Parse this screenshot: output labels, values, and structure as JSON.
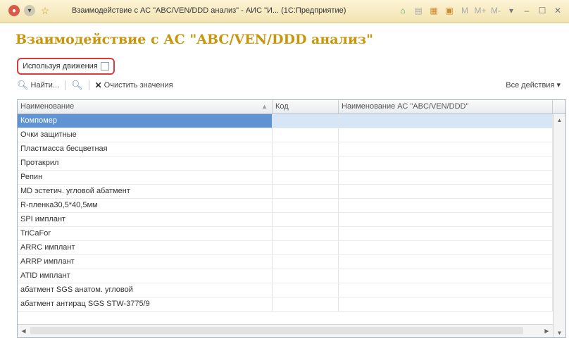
{
  "window": {
    "title": "Взаимодействие с АС \"ABC/VEN/DDD анализ\" - АИС \"И... (1С:Предприятие)"
  },
  "form": {
    "title": "Взаимодействие с АС \"ABC/VEN/DDD анализ\"",
    "use_movements_label": "Используя движения",
    "use_movements_checked": false
  },
  "toolbar": {
    "find_label": "Найти...",
    "clear_label": "Очистить значения",
    "all_actions_label": "Все действия ▾"
  },
  "table": {
    "columns": [
      "Наименование",
      "Код",
      "Наименование АС \"ABC/VEN/DDD\""
    ],
    "rows": [
      {
        "name": "Компомер",
        "code": "",
        "abc": ""
      },
      {
        "name": "Очки защитные",
        "code": "",
        "abc": ""
      },
      {
        "name": "Пластмасса бесцветная",
        "code": "",
        "abc": ""
      },
      {
        "name": "Протакрил",
        "code": "",
        "abc": ""
      },
      {
        "name": "Репин",
        "code": "",
        "abc": ""
      },
      {
        "name": "MD эстетич. угловой абатмент",
        "code": "",
        "abc": ""
      },
      {
        "name": "R-пленка30,5*40,5мм",
        "code": "",
        "abc": ""
      },
      {
        "name": "SPI имплант",
        "code": "",
        "abc": ""
      },
      {
        "name": "TriCaFor",
        "code": "",
        "abc": ""
      },
      {
        "name": "ARRC имплант",
        "code": "",
        "abc": ""
      },
      {
        "name": "ARRP имплант",
        "code": "",
        "abc": ""
      },
      {
        "name": "ATID имплант",
        "code": "",
        "abc": ""
      },
      {
        "name": "абатмент SGS анатом. угловой",
        "code": "",
        "abc": ""
      },
      {
        "name": "абатмент антирац SGS STW-3775/9",
        "code": "",
        "abc": ""
      }
    ],
    "selected_row": 0
  },
  "colors": {
    "title_gold": "#c8960c",
    "highlight_red": "#d93b3b",
    "selection_blue": "#5f93d3"
  }
}
